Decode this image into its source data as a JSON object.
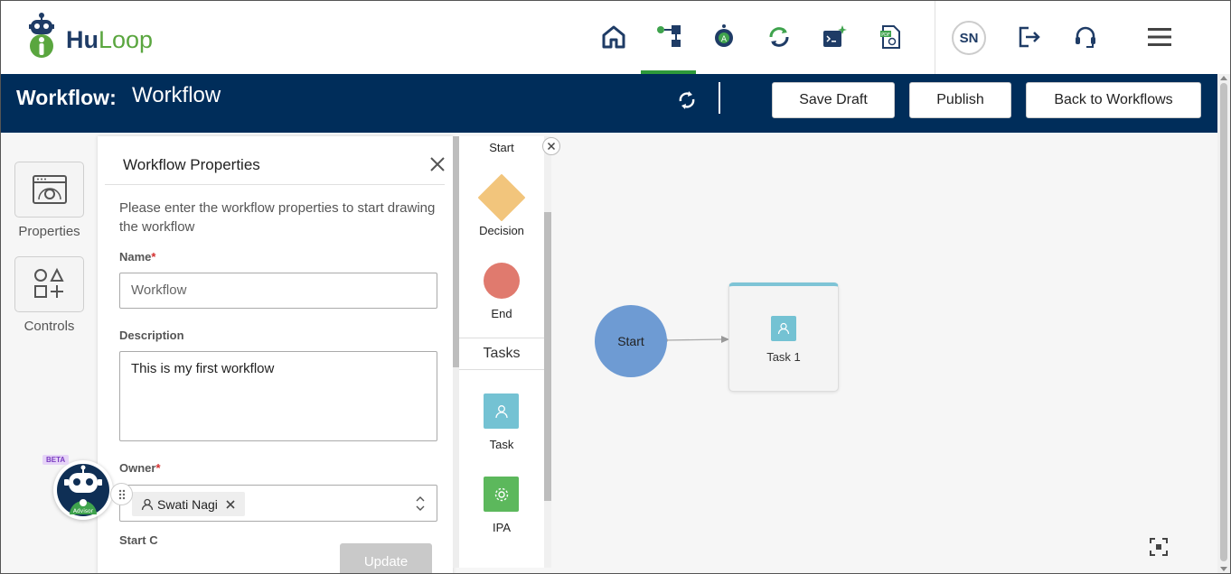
{
  "app": {
    "logo_text_hu": "Hu",
    "logo_text_loop": "Loop",
    "user_initials": "SN"
  },
  "nav_icons": [
    "home-icon",
    "workflow-icon",
    "automation-icon",
    "sync-cycle-icon",
    "script-icon",
    "pdf-settings-icon"
  ],
  "header": {
    "title_label": "Workflow:",
    "title_value": "Workflow",
    "save_draft_label": "Save Draft",
    "publish_label": "Publish",
    "back_label": "Back to Workflows"
  },
  "left_toolbar": {
    "properties_label": "Properties",
    "controls_label": "Controls"
  },
  "properties_panel": {
    "title": "Workflow Properties",
    "intro": "Please enter the workflow properties to start drawing the workflow",
    "name_label": "Name",
    "name_value": "Workflow",
    "description_label": "Description",
    "description_value": "This is my first workflow",
    "owner_label": "Owner",
    "owner_value": "Swati Nagi",
    "next_label_partial": "Start C",
    "update_label": "Update"
  },
  "palette": {
    "start_label": "Start",
    "decision_label": "Decision",
    "end_label": "End",
    "tasks_section": "Tasks",
    "task_label": "Task",
    "ipa_label": "IPA"
  },
  "canvas": {
    "start_node_label": "Start",
    "task_node_label": "Task 1"
  },
  "advisor": {
    "beta_label": "BETA",
    "advisor_label": "Advisor"
  },
  "colors": {
    "header_bg": "#002d5a",
    "active_nav": "#2e9a3a",
    "start_node": "#6e9bd3",
    "decision": "#f2c57c",
    "end": "#e07a6e",
    "task": "#74c2d3",
    "ipa": "#5cb85c"
  }
}
